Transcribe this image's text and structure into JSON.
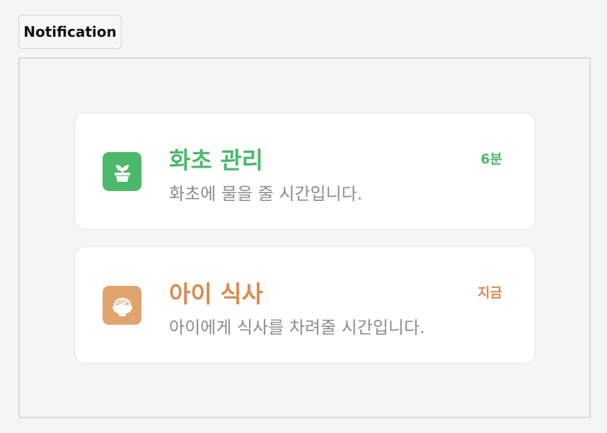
{
  "tab": {
    "label": "Notification"
  },
  "notifications": [
    {
      "title": "화초 관리",
      "message": "화초에 물을 줄 시간입니다.",
      "time": "6분",
      "icon": "plant-pot-icon",
      "accent": "#4cb86a"
    },
    {
      "title": "아이 식사",
      "message": "아이에게 식사를 차려줄 시간입니다.",
      "time": "지금",
      "icon": "rice-bowl-icon",
      "accent": "#dc8a4f"
    }
  ],
  "colors": {
    "background": "#f4f5f6",
    "card": "#ffffff",
    "message_text": "#8a8d90",
    "icon_plant_bg": "#4cb86a",
    "icon_bowl_bg": "#e0a46e"
  }
}
